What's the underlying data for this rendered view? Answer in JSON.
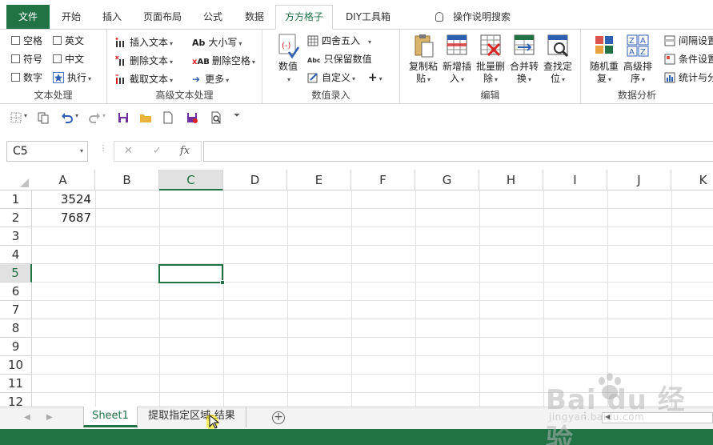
{
  "ribbon_tabs": [
    {
      "label": "文件"
    },
    {
      "label": "开始"
    },
    {
      "label": "插入"
    },
    {
      "label": "页面布局"
    },
    {
      "label": "公式"
    },
    {
      "label": "数据"
    },
    {
      "label": "方方格子"
    },
    {
      "label": "DIY工具箱"
    }
  ],
  "active_tab": "方方格子",
  "tell_me": "操作说明搜索",
  "groups": {
    "text": {
      "label": "文本处理",
      "items": [
        "空格",
        "英文",
        "符号",
        "中文",
        "数字",
        "执行"
      ]
    },
    "adv_text": {
      "label": "高级文本处理",
      "items": [
        "插入文本",
        "删除文本",
        "截取文本",
        "大小写",
        "删除空格",
        "更多"
      ],
      "ab_prefix": "Ab",
      "ab_prefix2": "AB"
    },
    "value_entry": {
      "label": "数值录入",
      "big": "数值",
      "items": [
        "四舍五入",
        "只保留数值",
        "自定义"
      ],
      "abc": "Abc",
      "plus": "+"
    },
    "edit": {
      "label": "编辑",
      "big": [
        {
          "l1": "复制粘",
          "l2": "贴"
        },
        {
          "l1": "新增插",
          "l2": "入"
        },
        {
          "l1": "批量删",
          "l2": "除"
        },
        {
          "l1": "合并转",
          "l2": "换"
        },
        {
          "l1": "查找定",
          "l2": "位"
        }
      ]
    },
    "analysis": {
      "label": "数据分析",
      "big": [
        {
          "l1": "随机重",
          "l2": "复"
        },
        {
          "l1": "高级排",
          "l2": "序"
        }
      ],
      "items": [
        "间隔设置",
        "条件设置",
        "统计与分"
      ]
    }
  },
  "formula_bar": {
    "name_box": "C5",
    "fx": "fx",
    "cancel": "✕",
    "confirm": "✓",
    "value": ""
  },
  "columns": [
    "A",
    "B",
    "C",
    "D",
    "E",
    "F",
    "G",
    "H",
    "I",
    "J",
    "K"
  ],
  "rows": [
    "1",
    "2",
    "3",
    "4",
    "5",
    "6",
    "7",
    "8",
    "9",
    "10",
    "11",
    "12"
  ],
  "cells": [
    {
      "ref": "A1",
      "value": "3524"
    },
    {
      "ref": "A2",
      "value": "7687"
    }
  ],
  "selected_cell": "C5",
  "sheets": [
    "Sheet1",
    "提取指定区域-结果"
  ],
  "active_sheet": "Sheet1",
  "watermark": {
    "brand": "Bai du 经验",
    "sub": "jingyan.baidu.com"
  },
  "colors": {
    "accent": "#217346",
    "grid": "#e1e1e1",
    "header_sel": "#e1e1e1"
  }
}
